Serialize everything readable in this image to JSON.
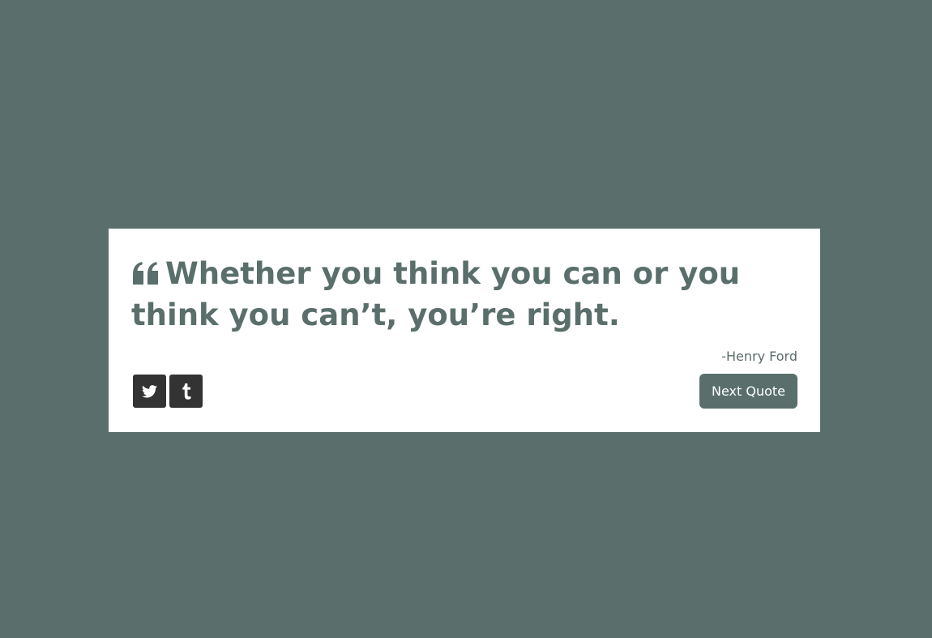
{
  "quote": {
    "text": "Whether you think you can or you think you can’t, you’re right.",
    "author": "-Henry Ford",
    "icon": "quote-left-icon"
  },
  "share": {
    "twitter_icon": "twitter-icon",
    "tumblr_icon": "tumblr-icon"
  },
  "actions": {
    "next_label": "Next Quote"
  },
  "colors": {
    "background": "#5a6f6b",
    "card": "#ffffff",
    "share_button": "#333333",
    "text": "#5a6f6b"
  }
}
